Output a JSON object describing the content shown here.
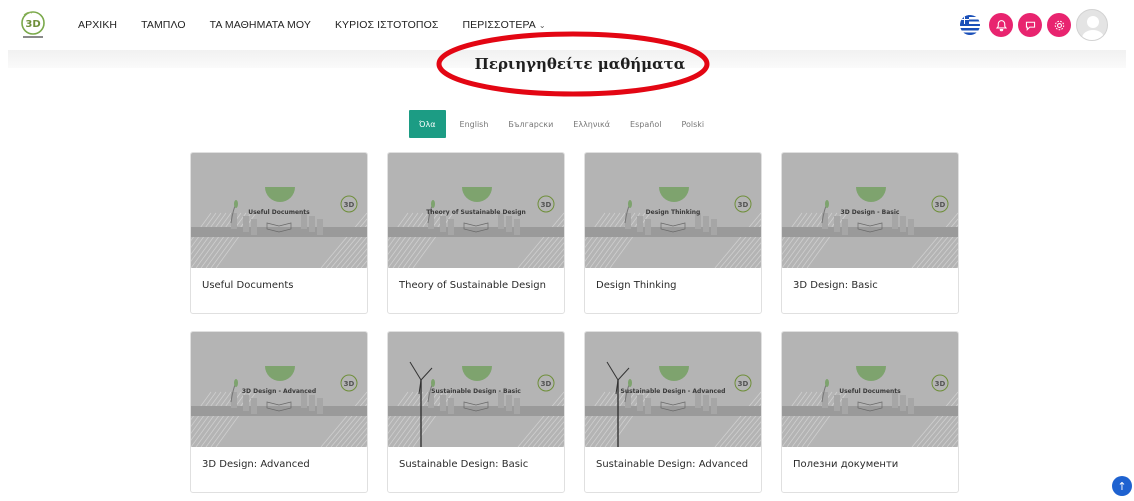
{
  "nav": {
    "items": [
      {
        "label": "ΑΡΧΙΚΗ"
      },
      {
        "label": "ΤΑΜΠΛΟ"
      },
      {
        "label": "ΤΑ ΜΑΘΗΜΑΤΑ ΜΟΥ"
      },
      {
        "label": "ΚΥΡΙΟΣ ΙΣΤΟΤΟΠΟΣ"
      },
      {
        "label": "ΠΕΡΙΣΣΟΤΕΡΑ"
      }
    ],
    "language_flag": "greece-flag-icon",
    "action_color": "#e8246f"
  },
  "heading": "Περιηγηθείτε μαθήματα",
  "annotation_color": "#e30613",
  "filters": [
    "Όλα",
    "English",
    "Български",
    "Ελληνικά",
    "Español",
    "Polski"
  ],
  "filter_active_color": "#1c9c84",
  "courses": [
    {
      "title": "Useful Documents",
      "thumb_label": "Useful Documents"
    },
    {
      "title": "Theory of Sustainable Design",
      "thumb_label": "Theory of Sustainable Design"
    },
    {
      "title": "Design Thinking",
      "thumb_label": "Design Thinking"
    },
    {
      "title": "3D Design: Basic",
      "thumb_label": "3D Design - Basic"
    },
    {
      "title": "3D Design: Advanced",
      "thumb_label": "3D Design - Advanced"
    },
    {
      "title": "Sustainable Design: Basic",
      "thumb_label": "Sustainable Design - Basic"
    },
    {
      "title": "Sustainable Design: Advanced",
      "thumb_label": "Sustainable Design - Advanced"
    },
    {
      "title": "Полезни документи",
      "thumb_label": "Useful Documents"
    }
  ],
  "back_to_top": "↑"
}
